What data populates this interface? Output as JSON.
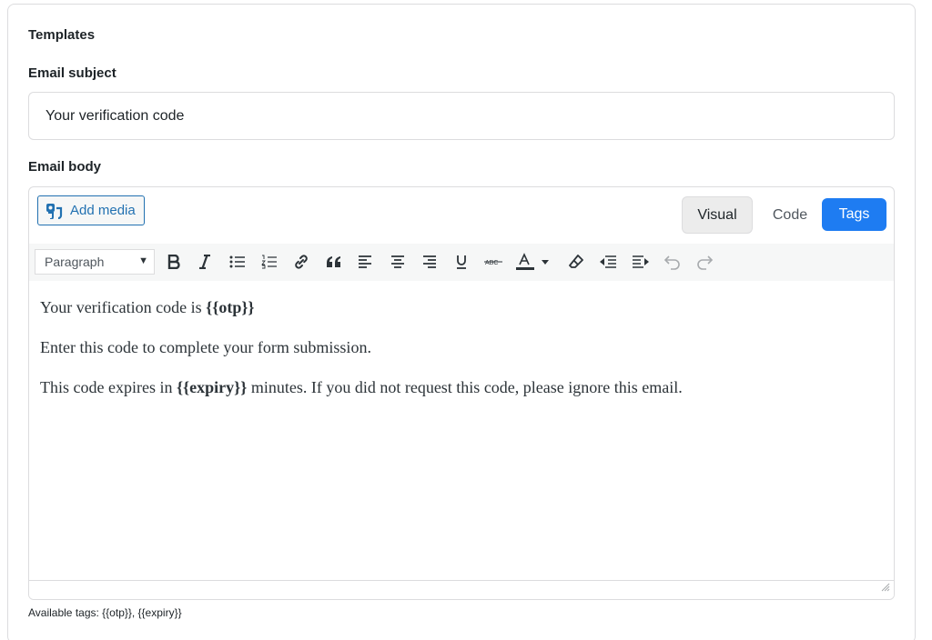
{
  "templates": {
    "title": "Templates",
    "subject_label": "Email subject",
    "subject_value": "Your verification code",
    "body_label": "Email body",
    "add_media_label": "Add media",
    "tabs": {
      "visual": "Visual",
      "code": "Code",
      "tags": "Tags"
    },
    "format_select_value": "Paragraph",
    "toolbar_icons": [
      "bold-icon",
      "italic-icon",
      "bulleted-list-icon",
      "numbered-list-icon",
      "link-icon",
      "blockquote-icon",
      "align-left-icon",
      "align-center-icon",
      "align-right-icon",
      "underline-icon",
      "strikethrough-icon",
      "text-color-icon",
      "clear-formatting-icon",
      "outdent-icon",
      "indent-icon",
      "undo-icon",
      "redo-icon"
    ],
    "body": {
      "p1_pre": "Your verification code is ",
      "p1_tag": "{{otp}}",
      "p2": "Enter this code to complete your form submission.",
      "p3_pre": "This code expires in ",
      "p3_tag": "{{expiry}}",
      "p3_post": " minutes. If you did not request this code, please ignore this email."
    },
    "available_tags": "Available tags: {{otp}}, {{expiry}}"
  },
  "colors": {
    "accent": "#1e7cf2",
    "link": "#2271b1",
    "border": "#dcdcde",
    "toolbar_bg": "#f6f7f7"
  }
}
